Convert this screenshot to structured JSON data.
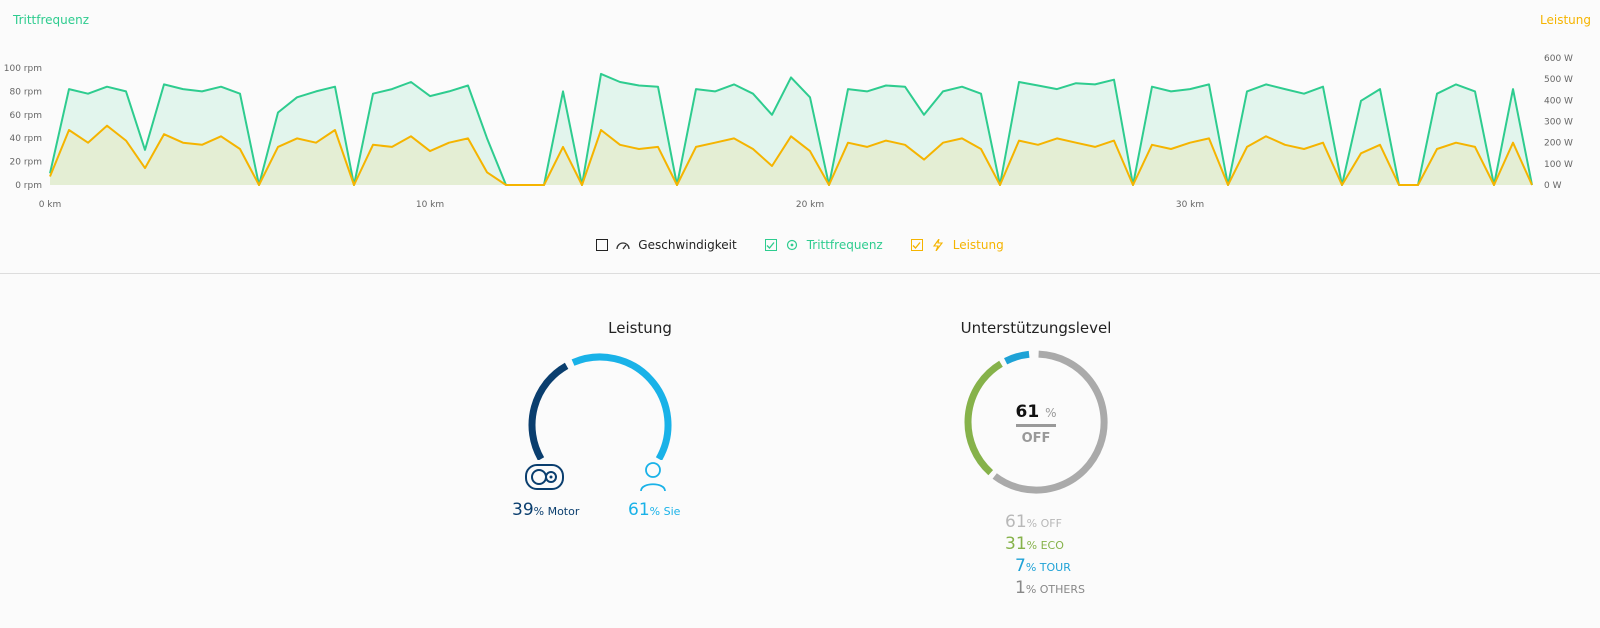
{
  "chart": {
    "left_title": "Trittfrequenz",
    "right_title": "Leistung",
    "left_ticks": [
      "100 rpm",
      "80 rpm",
      "60 rpm",
      "40 rpm",
      "20 rpm",
      "0 rpm"
    ],
    "right_ticks": [
      "600 W",
      "500 W",
      "400 W",
      "300 W",
      "200 W",
      "100 W",
      "0 W"
    ],
    "x_ticks": [
      "0 km",
      "10 km",
      "20 km",
      "30 km"
    ]
  },
  "chart_data": {
    "type": "line",
    "x_label": "",
    "xlim": [
      0,
      39
    ],
    "series": [
      {
        "name": "Trittfrequenz",
        "axis": "left",
        "unit": "rpm",
        "ylim": [
          0,
          100
        ],
        "color": "#2ecc8f",
        "x": [
          0,
          0.5,
          1,
          1.5,
          2,
          2.5,
          3,
          3.5,
          4,
          4.5,
          5,
          5.5,
          6,
          6.5,
          7,
          7.5,
          8,
          8.5,
          9,
          9.5,
          10,
          10.5,
          11,
          11.5,
          12,
          12.5,
          13,
          13.5,
          14,
          14.5,
          15,
          15.5,
          16,
          16.5,
          17,
          17.5,
          18,
          18.5,
          19,
          19.5,
          20,
          20.5,
          21,
          21.5,
          22,
          22.5,
          23,
          23.5,
          24,
          24.5,
          25,
          25.5,
          26,
          26.5,
          27,
          27.5,
          28,
          28.5,
          29,
          29.5,
          30,
          30.5,
          31,
          31.5,
          32,
          32.5,
          33,
          33.5,
          34,
          34.5,
          35,
          35.5,
          36,
          36.5,
          37,
          37.5,
          38,
          38.5,
          39
        ],
        "y": [
          10,
          82,
          78,
          84,
          80,
          30,
          86,
          82,
          80,
          84,
          78,
          0,
          62,
          75,
          80,
          84,
          0,
          78,
          82,
          88,
          76,
          80,
          85,
          40,
          0,
          0,
          0,
          80,
          0,
          95,
          88,
          85,
          84,
          0,
          82,
          80,
          86,
          78,
          60,
          92,
          75,
          0,
          82,
          80,
          85,
          84,
          60,
          80,
          84,
          78,
          0,
          88,
          85,
          82,
          87,
          86,
          90,
          0,
          84,
          80,
          82,
          86,
          0,
          80,
          86,
          82,
          78,
          84,
          0,
          72,
          82,
          0,
          0,
          78,
          86,
          80,
          0,
          82,
          0
        ]
      },
      {
        "name": "Leistung",
        "axis": "right",
        "unit": "W",
        "ylim": [
          0,
          600
        ],
        "color": "#f5b400",
        "x": [
          0,
          0.5,
          1,
          1.5,
          2,
          2.5,
          3,
          3.5,
          4,
          4.5,
          5,
          5.5,
          6,
          6.5,
          7,
          7.5,
          8,
          8.5,
          9,
          9.5,
          10,
          10.5,
          11,
          11.5,
          12,
          12.5,
          13,
          13.5,
          14,
          14.5,
          15,
          15.5,
          16,
          16.5,
          17,
          17.5,
          18,
          18.5,
          19,
          19.5,
          20,
          20.5,
          21,
          21.5,
          22,
          22.5,
          23,
          23.5,
          24,
          24.5,
          25,
          25.5,
          26,
          26.5,
          27,
          27.5,
          28,
          28.5,
          29,
          29.5,
          30,
          30.5,
          31,
          31.5,
          32,
          32.5,
          33,
          33.5,
          34,
          34.5,
          35,
          35.5,
          36,
          36.5,
          37,
          37.5,
          38,
          38.5,
          39
        ],
        "y": [
          40,
          260,
          200,
          280,
          210,
          80,
          240,
          200,
          190,
          230,
          170,
          0,
          180,
          220,
          200,
          260,
          0,
          190,
          180,
          230,
          160,
          200,
          220,
          60,
          0,
          0,
          0,
          180,
          0,
          260,
          190,
          170,
          180,
          0,
          180,
          200,
          220,
          170,
          90,
          230,
          160,
          0,
          200,
          180,
          210,
          190,
          120,
          200,
          220,
          170,
          0,
          210,
          190,
          220,
          200,
          180,
          210,
          0,
          190,
          170,
          200,
          220,
          0,
          180,
          230,
          190,
          170,
          200,
          0,
          150,
          190,
          0,
          0,
          170,
          200,
          180,
          0,
          200,
          0
        ]
      }
    ]
  },
  "legend": {
    "speed_label": "Geschwindigkeit",
    "cadence_label": "Trittfrequenz",
    "power_label": "Leistung"
  },
  "leistung": {
    "title": "Leistung",
    "motor_pct": "39",
    "motor_unit": "% Motor",
    "rider_pct": "61",
    "rider_unit": "% Sie",
    "motor_value": 39,
    "rider_value": 61,
    "motor_color": "#0a3e6e",
    "rider_color": "#19b2e8"
  },
  "level": {
    "title": "Unterstützungslevel",
    "center_value": "61",
    "center_unit": "%",
    "center_label": "OFF",
    "rows": [
      {
        "pct": "61",
        "label": "% OFF",
        "value": 61,
        "color": "#aaaaaa"
      },
      {
        "pct": "31",
        "label": "% ECO",
        "value": 31,
        "color": "#86b24a"
      },
      {
        "pct": "7",
        "label": "% TOUR",
        "value": 7,
        "color": "#1ea2d6"
      },
      {
        "pct": "1",
        "label": "% OTHERS",
        "value": 1,
        "color": "#888888"
      }
    ]
  }
}
